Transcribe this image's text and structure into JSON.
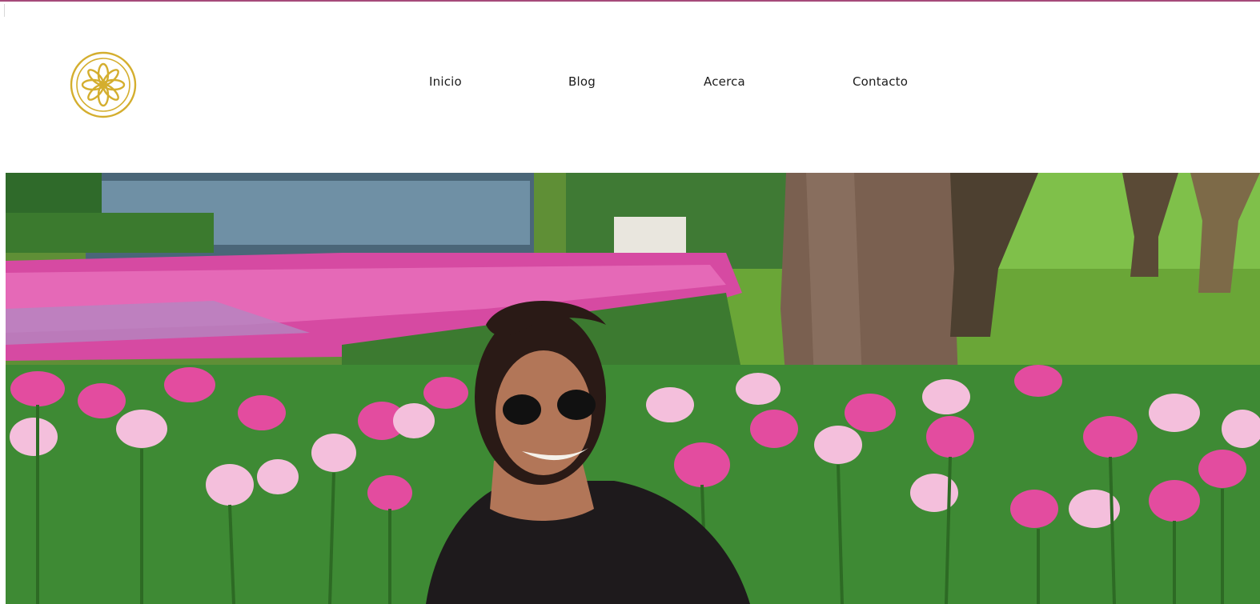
{
  "nav": {
    "items": [
      {
        "label": "Inicio"
      },
      {
        "label": "Blog"
      },
      {
        "label": "Acerca"
      },
      {
        "label": "Contacto"
      }
    ]
  },
  "brand": {
    "logo_icon": "floral-emblem-icon",
    "logo_color": "#d4ae2e",
    "accent_color": "#a64a7a"
  },
  "hero": {
    "image_subject": "woman-in-tulip-garden"
  }
}
